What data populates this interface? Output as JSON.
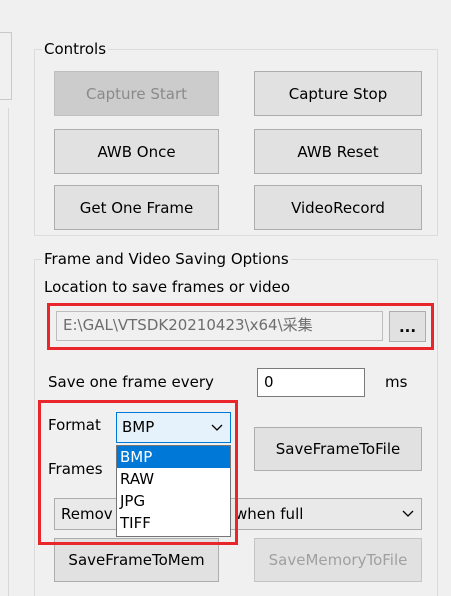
{
  "controls": {
    "legend": "Controls",
    "capture_start": "Capture Start",
    "capture_stop": "Capture Stop",
    "awb_once": "AWB Once",
    "awb_reset": "AWB Reset",
    "get_one_frame": "Get One Frame",
    "video_record": "VideoRecord"
  },
  "saving": {
    "legend": "Frame and Video Saving Options",
    "location_legend": "Location to save frames or video",
    "path_value": "E:\\GAL\\VTSDK20210423\\x64\\采集",
    "browse_label": "...",
    "save_every_label": "Save one frame every",
    "interval_value": "0",
    "interval_unit": "ms",
    "format_label": "Format",
    "format_selected": "BMP",
    "format_options": [
      "BMP",
      "RAW",
      "JPG",
      "TIFF"
    ],
    "frames_label": "Frames",
    "mode_left": "Remov",
    "mode_right": "when full",
    "save_frame_to_file": "SaveFrameToFile",
    "save_frame_to_mem": "SaveFrameToMem",
    "save_memory_to_file": "SaveMemoryToFile"
  },
  "colors": {
    "highlight": "#e8262b",
    "selection": "#0078d7"
  }
}
